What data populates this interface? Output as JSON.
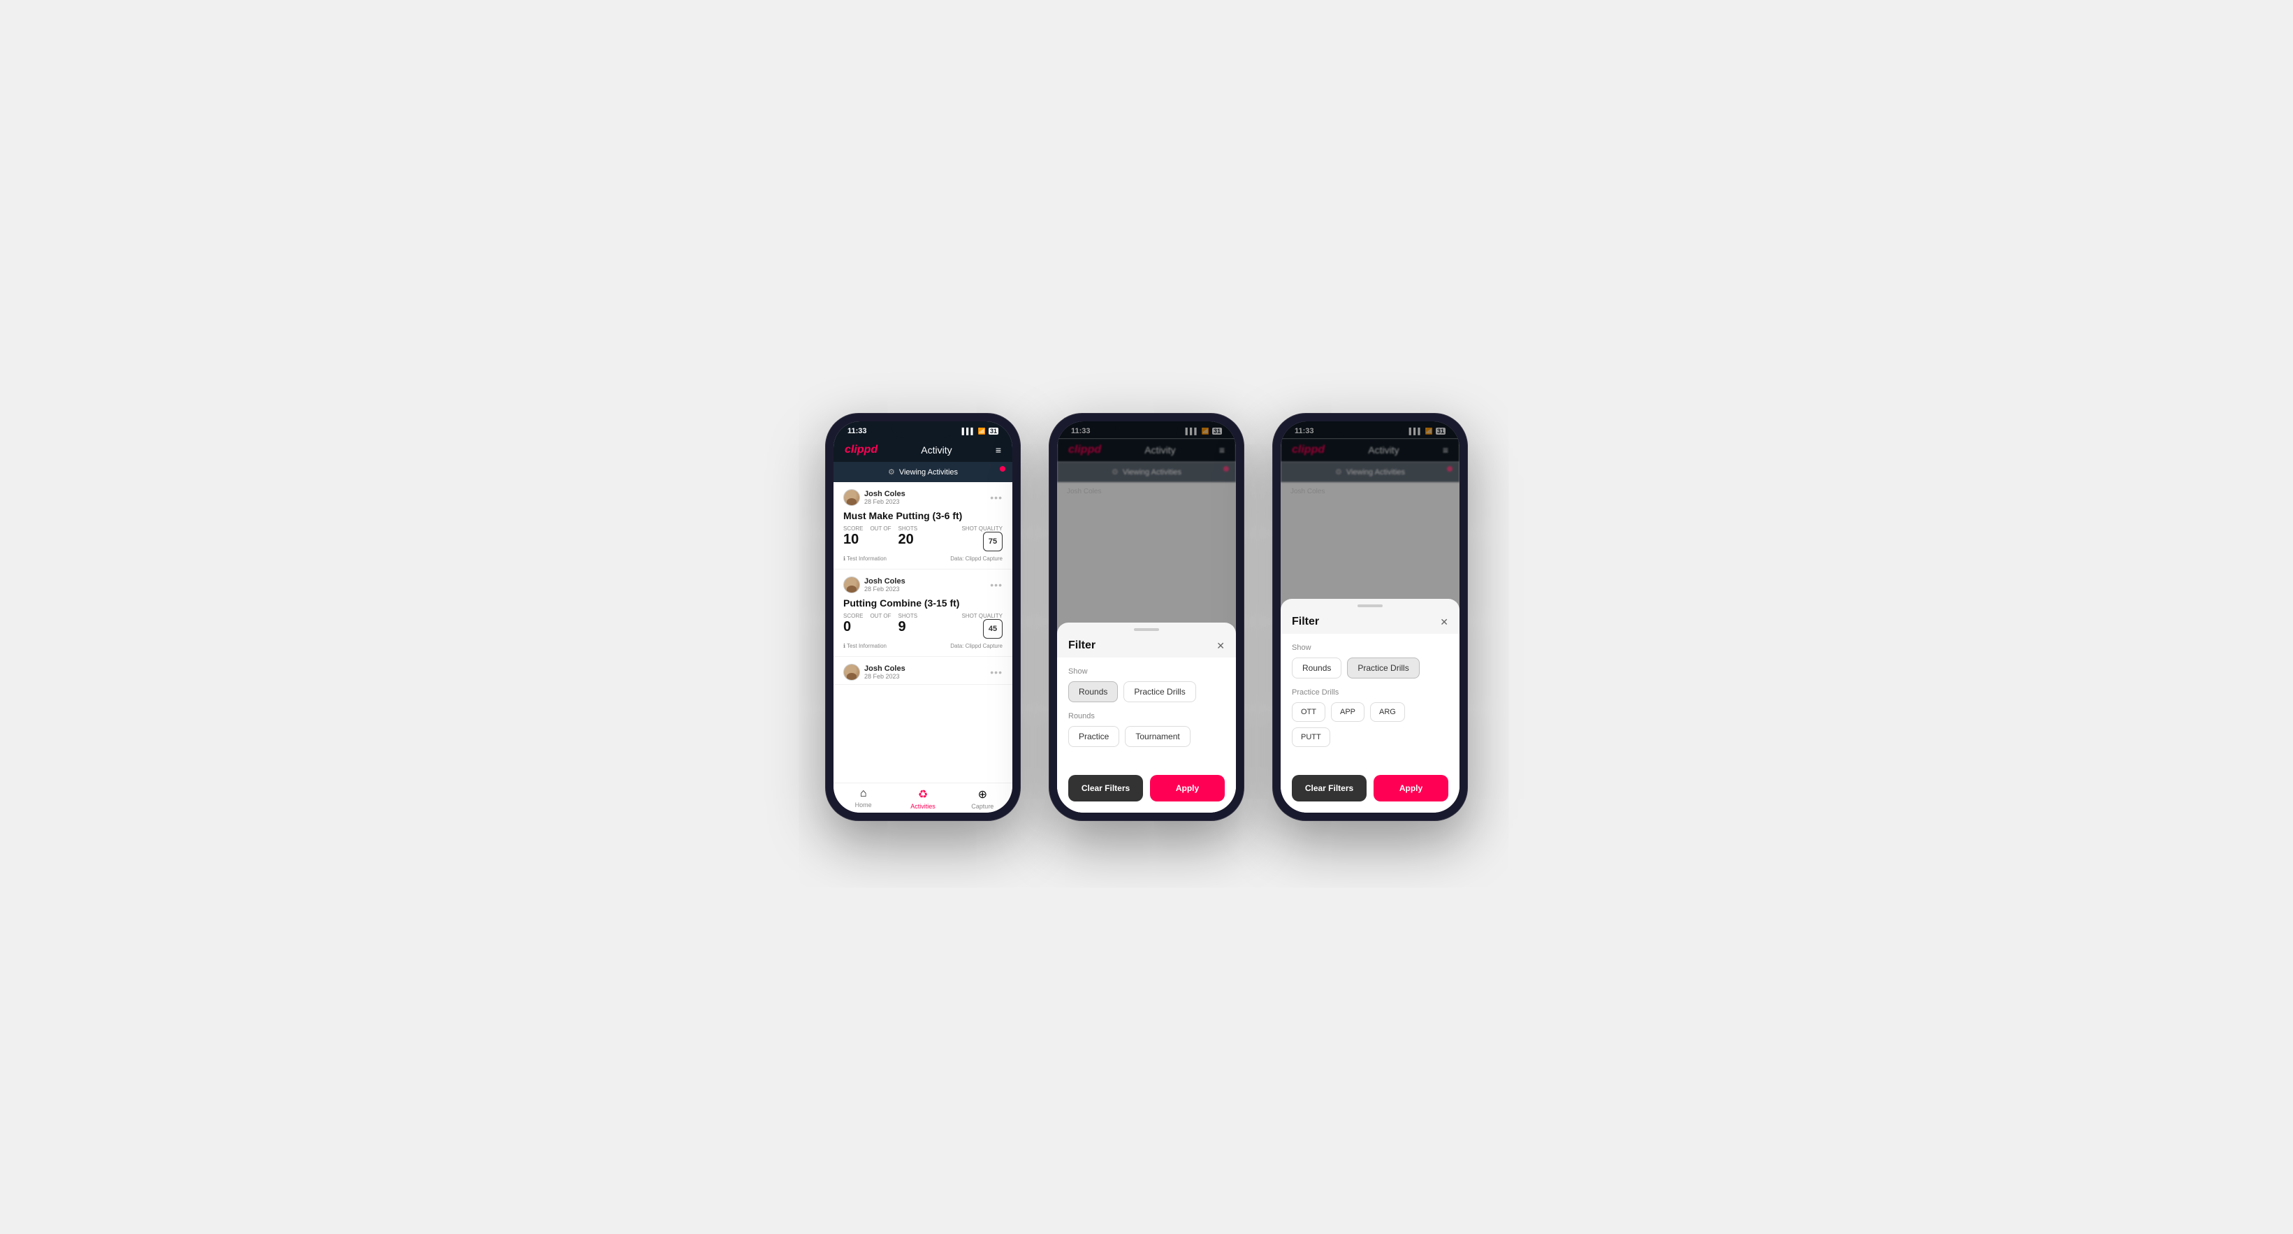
{
  "phones": [
    {
      "id": "phone1",
      "type": "activity_list",
      "status": {
        "time": "11:33",
        "signal": "●●●",
        "wifi": "WiFi",
        "battery": "31"
      },
      "header": {
        "logo": "clippd",
        "title": "Activity",
        "menu": "≡"
      },
      "viewing_bar": {
        "icon": "⚙",
        "text": "Viewing Activities"
      },
      "cards": [
        {
          "user": "Josh Coles",
          "date": "28 Feb 2023",
          "title": "Must Make Putting (3-6 ft)",
          "score_label": "Score",
          "score": "10",
          "shots_label": "Shots",
          "shots": "20",
          "quality_label": "Shot Quality",
          "quality": "75",
          "info": "Test Information",
          "data": "Data: Clippd Capture"
        },
        {
          "user": "Josh Coles",
          "date": "28 Feb 2023",
          "title": "Putting Combine (3-15 ft)",
          "score_label": "Score",
          "score": "0",
          "shots_label": "Shots",
          "shots": "9",
          "quality_label": "Shot Quality",
          "quality": "45",
          "info": "Test Information",
          "data": "Data: Clippd Capture"
        },
        {
          "user": "Josh Coles",
          "date": "28 Feb 2023",
          "title": "",
          "score_label": "",
          "score": "",
          "shots_label": "",
          "shots": "",
          "quality_label": "",
          "quality": "",
          "info": "",
          "data": ""
        }
      ],
      "tabs": [
        {
          "icon": "⌂",
          "label": "Home",
          "active": false
        },
        {
          "icon": "♻",
          "label": "Activities",
          "active": true
        },
        {
          "icon": "⊕",
          "label": "Capture",
          "active": false
        }
      ]
    },
    {
      "id": "phone2",
      "type": "filter_rounds",
      "status": {
        "time": "11:33",
        "signal": "●●●",
        "wifi": "WiFi",
        "battery": "31"
      },
      "header": {
        "logo": "clippd",
        "title": "Activity",
        "menu": "≡"
      },
      "viewing_bar": {
        "icon": "⚙",
        "text": "Viewing Activities"
      },
      "filter": {
        "title": "Filter",
        "show_label": "Show",
        "show_buttons": [
          {
            "label": "Rounds",
            "selected": true
          },
          {
            "label": "Practice Drills",
            "selected": false
          }
        ],
        "rounds_label": "Rounds",
        "round_buttons": [
          {
            "label": "Practice",
            "selected": false
          },
          {
            "label": "Tournament",
            "selected": false
          }
        ],
        "clear_label": "Clear Filters",
        "apply_label": "Apply"
      }
    },
    {
      "id": "phone3",
      "type": "filter_drills",
      "status": {
        "time": "11:33",
        "signal": "●●●",
        "wifi": "WiFi",
        "battery": "31"
      },
      "header": {
        "logo": "clippd",
        "title": "Activity",
        "menu": "≡"
      },
      "viewing_bar": {
        "icon": "⚙",
        "text": "Viewing Activities"
      },
      "filter": {
        "title": "Filter",
        "show_label": "Show",
        "show_buttons": [
          {
            "label": "Rounds",
            "selected": false
          },
          {
            "label": "Practice Drills",
            "selected": true
          }
        ],
        "drills_label": "Practice Drills",
        "drill_buttons": [
          {
            "label": "OTT",
            "selected": false
          },
          {
            "label": "APP",
            "selected": false
          },
          {
            "label": "ARG",
            "selected": false
          },
          {
            "label": "PUTT",
            "selected": false
          }
        ],
        "clear_label": "Clear Filters",
        "apply_label": "Apply"
      }
    }
  ]
}
